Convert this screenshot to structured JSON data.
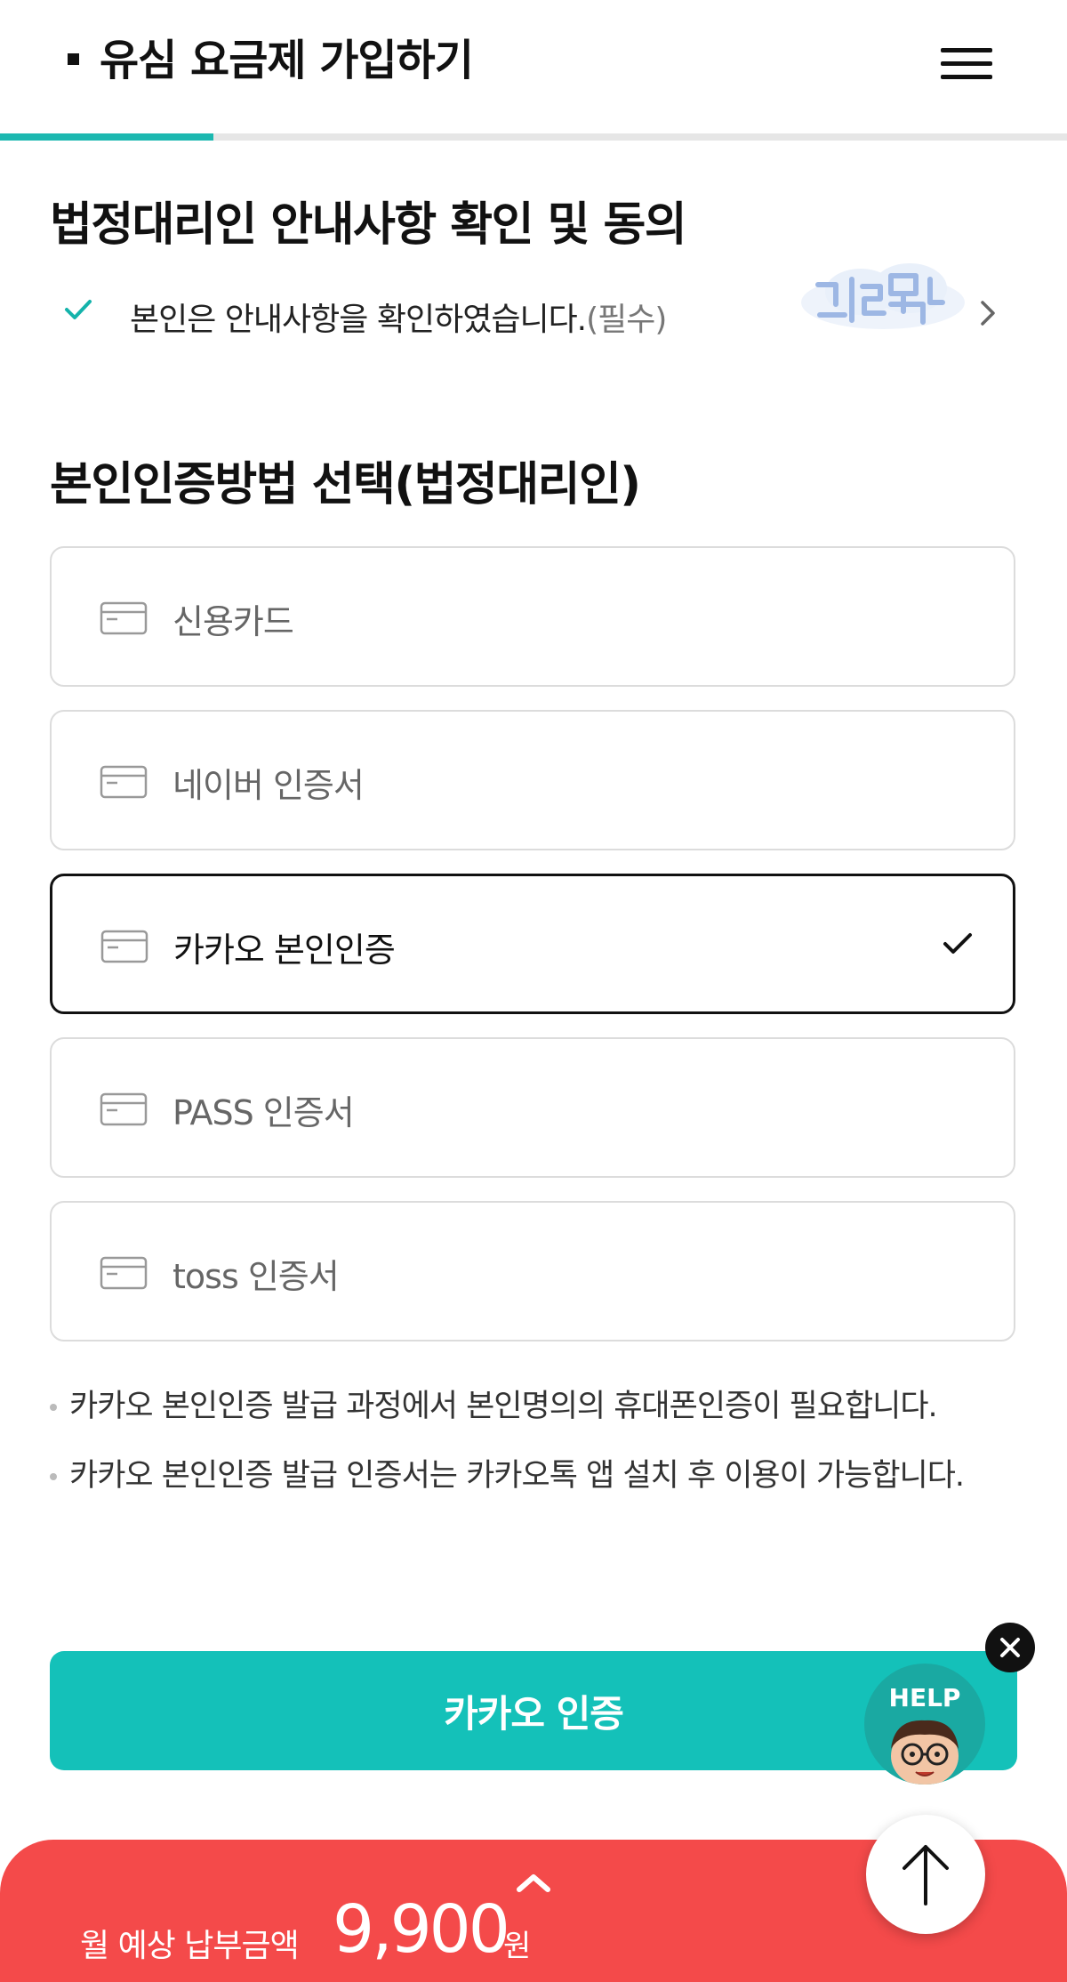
{
  "header": {
    "title": "유심 요금제 가입하기",
    "menu_icon": "hamburger-menu-icon",
    "progress_fraction": 0.2,
    "progress_color": "#1cb8b0"
  },
  "guardian_notice": {
    "title": "법정대리인 안내사항 확인 및 동의",
    "agree_text": "본인은 안내사항을 확인하였습니다.",
    "required_text": "(필수)",
    "checked": true
  },
  "auth_method": {
    "title": "본인인증방법 선택(법정대리인)",
    "options": [
      {
        "label": "신용카드",
        "selected": false
      },
      {
        "label": "네이버 인증서",
        "selected": false
      },
      {
        "label": "카카오 본인인증",
        "selected": true
      },
      {
        "label": "PASS 인증서",
        "selected": false
      },
      {
        "label": "toss 인증서",
        "selected": false
      }
    ],
    "notes": [
      "카카오 본인인증 발급 과정에서 본인명의의 휴대폰인증이 필요합니다.",
      "카카오 본인인증 발급 인증서는 카카오톡 앱 설치 후 이용이 가능합니다."
    ]
  },
  "cta": {
    "label": "카카오 인증",
    "color": "#14c1b9"
  },
  "help_widget": {
    "label": "HELP"
  },
  "bottom_bar": {
    "label": "월 예상 납부금액",
    "amount": "9,900",
    "unit": "원",
    "color": "#f44a4a"
  },
  "colors": {
    "accent": "#14c1b9",
    "price_bar": "#f44a4a"
  }
}
